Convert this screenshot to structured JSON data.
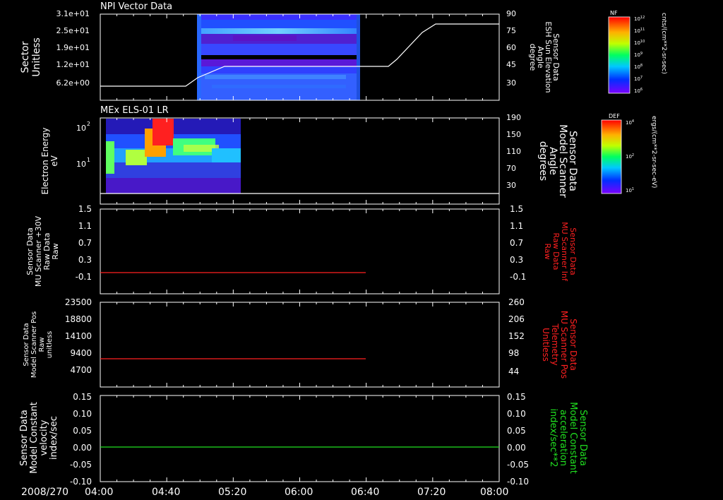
{
  "figure": {
    "date_label": "2008/270",
    "time_ticks": [
      "04:00",
      "04:40",
      "05:20",
      "06:00",
      "06:40",
      "07:20",
      "08:00"
    ]
  },
  "panels": [
    {
      "title": "NPI Vector Data",
      "left_label": [
        "Sector",
        "Unitless"
      ],
      "left_ticks": [
        "3.1e+01",
        "2.5e+01",
        "1.9e+01",
        "1.2e+01",
        "6.2e+00"
      ],
      "right_label": [
        "Sensor Data",
        "ESH Sun Elevation",
        "Angle",
        "degree"
      ],
      "right_ticks": [
        "90",
        "75",
        "60",
        "45",
        "30"
      ],
      "right_label_color": "#ffffff"
    },
    {
      "title": "MEx ELS-01 LR",
      "left_label": [
        "Electron Energy",
        "eV"
      ],
      "left_ticks": [
        "10",
        "10"
      ],
      "left_tick_exps": [
        "2",
        "1"
      ],
      "right_label": [
        "Sensor Data",
        "Model Scanner",
        "Angle",
        "degrees"
      ],
      "right_ticks": [
        "190",
        "150",
        "110",
        "70",
        "30"
      ],
      "right_label_color": "#ffffff"
    },
    {
      "title": "",
      "left_label": [
        "Sensor Data",
        "MU Scanner +30V",
        "Raw Data",
        "Raw"
      ],
      "left_ticks": [
        "1.5",
        "1.1",
        "0.7",
        "0.3",
        "-0.1"
      ],
      "right_label": [
        "Sensor Data",
        "MU Scanner Inf",
        "Raw Data",
        "Raw"
      ],
      "right_ticks": [
        "1.5",
        "1.1",
        "0.7",
        "0.3",
        "-0.1"
      ],
      "right_label_color": "#ff2020"
    },
    {
      "title": "",
      "left_label": [
        "Sensor Data",
        "Model Scanner Pos",
        "Raw",
        "unitless"
      ],
      "left_ticks": [
        "23500",
        "18800",
        "14100",
        "9400",
        "4700"
      ],
      "right_label": [
        "Sensor Data",
        "MU Scanner Pos",
        "Telemetry",
        "Unitless"
      ],
      "right_ticks": [
        "260",
        "206",
        "152",
        "98",
        "44"
      ],
      "right_label_color": "#ff2020"
    },
    {
      "title": "",
      "left_label": [
        "Sensor Data",
        "Model Constant",
        "velocity",
        "index/sec"
      ],
      "left_ticks": [
        "0.15",
        "0.10",
        "0.05",
        "0.00",
        "-0.05",
        "-0.10"
      ],
      "right_label": [
        "Sensor Data",
        "Model Constant",
        "acceleration",
        "index/sec**2"
      ],
      "right_ticks": [
        "0.15",
        "0.10",
        "0.05",
        "0.00",
        "-0.05",
        "-0.10"
      ],
      "right_label_color": "#20e020"
    }
  ],
  "colorbars": [
    {
      "name": "NF",
      "unit": "cnts/(cm**2-sr-sec)",
      "ticks": [
        "10",
        "10",
        "10",
        "10",
        "10",
        "10",
        "10"
      ],
      "tick_exps": [
        "12",
        "11",
        "10",
        "9",
        "8",
        "7",
        "6"
      ]
    },
    {
      "name": "DEF",
      "unit": "ergs/(cm**2-sr-sec-eV)",
      "ticks": [
        "10",
        "10",
        "10"
      ],
      "tick_exps": [
        "4",
        "2",
        "1"
      ]
    }
  ],
  "colors": {
    "background": "#000000",
    "axes": "#ffffff",
    "trace_red": "#ff2020",
    "trace_green": "#20e020"
  },
  "chart_data": [
    {
      "type": "heatmap",
      "panel": 0,
      "title": "NPI Vector Data",
      "x_range": [
        "04:00",
        "08:00"
      ],
      "data_x_range": [
        "04:53",
        "06:38"
      ],
      "ylabel": "Sector Unitless",
      "y_ticks": [
        31,
        25,
        19,
        12,
        6.2
      ],
      "line_series": {
        "name": "ESH Sun Elevation Angle",
        "x_hours": [
          4.0,
          4.72,
          5.0,
          5.25,
          6.65,
          6.8,
          7.05,
          7.22,
          8.0
        ],
        "y": [
          24,
          24,
          30,
          43,
          43,
          50,
          70,
          80,
          80
        ],
        "ylim": [
          15,
          90
        ]
      }
    },
    {
      "type": "heatmap",
      "panel": 1,
      "title": "MEx ELS-01 LR",
      "x_range": [
        "04:00",
        "08:00"
      ],
      "data_x_range": [
        "04:00",
        "05:25"
      ],
      "ylabel": "Electron Energy eV",
      "yscale": "log",
      "line_series": {
        "name": "Model Scanner Angle",
        "x_hours": [
          4.0,
          8.0
        ],
        "y": [
          15,
          15
        ],
        "ylim": [
          0,
          190
        ]
      }
    },
    {
      "type": "line",
      "panel": 2,
      "series": [
        {
          "name": "MU Scanner Inf Raw Data",
          "x_hours": [
            4.0,
            6.65
          ],
          "y": [
            -0.05,
            -0.05
          ],
          "color": "#ff2020"
        }
      ],
      "ylim": [
        -0.4,
        1.5
      ]
    },
    {
      "type": "line",
      "panel": 3,
      "series": [
        {
          "name": "MU Scanner Pos Telemetry",
          "x_hours": [
            4.0,
            6.65
          ],
          "y": [
            8800,
            8800
          ],
          "color": "#ff2020"
        }
      ],
      "ylim": [
        0,
        23500
      ]
    },
    {
      "type": "line",
      "panel": 4,
      "series": [
        {
          "name": "Model Constant acceleration",
          "x_hours": [
            4.0,
            8.0
          ],
          "y": [
            0.0,
            0.0
          ],
          "color": "#20e020"
        }
      ],
      "ylim": [
        -0.1,
        0.15
      ]
    }
  ]
}
